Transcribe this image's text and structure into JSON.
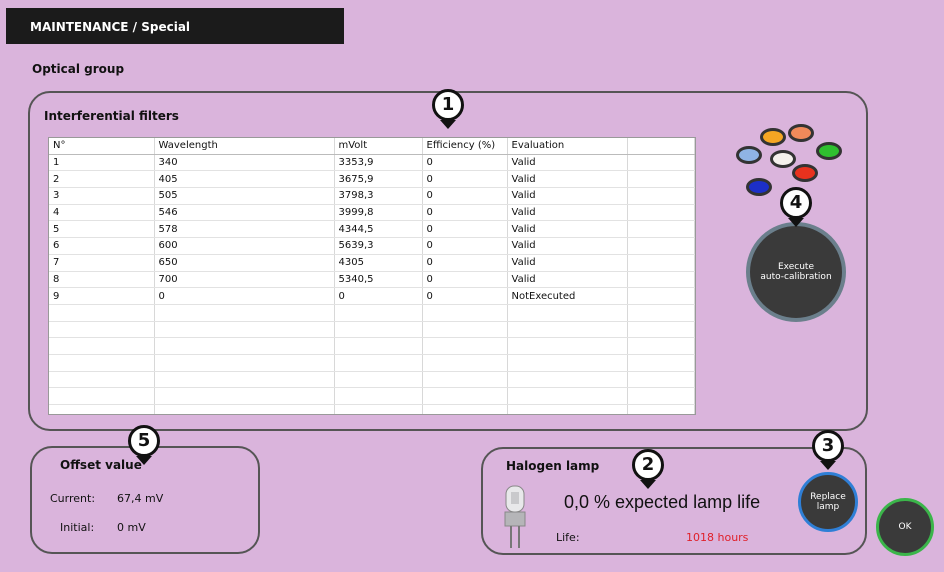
{
  "title": "MAINTENANCE / Special",
  "section": "Optical group",
  "filters_panel": {
    "title": "Interferential filters",
    "columns": [
      "N°",
      "Wavelength",
      "mVolt",
      "Efficiency (%)",
      "Evaluation",
      ""
    ],
    "rows": [
      [
        "1",
        "340",
        "3353,9",
        "0",
        "Valid",
        ""
      ],
      [
        "2",
        "405",
        "3675,9",
        "0",
        "Valid",
        ""
      ],
      [
        "3",
        "505",
        "3798,3",
        "0",
        "Valid",
        ""
      ],
      [
        "4",
        "546",
        "3999,8",
        "0",
        "Valid",
        ""
      ],
      [
        "5",
        "578",
        "4344,5",
        "0",
        "Valid",
        ""
      ],
      [
        "6",
        "600",
        "5639,3",
        "0",
        "Valid",
        ""
      ],
      [
        "7",
        "650",
        "4305",
        "0",
        "Valid",
        ""
      ],
      [
        "8",
        "700",
        "5340,5",
        "0",
        "Valid",
        ""
      ],
      [
        "9",
        "0",
        "0",
        "0",
        "NotExecuted",
        ""
      ],
      [
        "",
        "",
        "",
        "",
        "",
        ""
      ],
      [
        "",
        "",
        "",
        "",
        "",
        ""
      ],
      [
        "",
        "",
        "",
        "",
        "",
        ""
      ],
      [
        "",
        "",
        "",
        "",
        "",
        ""
      ],
      [
        "",
        "",
        "",
        "",
        "",
        ""
      ],
      [
        "",
        "",
        "",
        "",
        "",
        ""
      ],
      [
        "",
        "",
        "",
        "",
        "",
        ""
      ]
    ],
    "filter_colors": [
      "#8fb4e4",
      "#f5a623",
      "#f08a5a",
      "#f4f1ec",
      "#2fbf2f",
      "#e8321e",
      "#1c2fc8"
    ]
  },
  "calibration_button": {
    "line1": "Execute",
    "line2": "auto-calibration"
  },
  "offset_panel": {
    "title": "Offset value",
    "current_label": "Current:",
    "current_value": "67,4 mV",
    "initial_label": "Initial:",
    "initial_value": "0 mV"
  },
  "lamp_panel": {
    "title": "Halogen lamp",
    "expected_life": "0,0 % expected lamp life",
    "life_label": "Life:",
    "life_value": "1018 hours",
    "life_color": "#e0202a"
  },
  "replace_button": {
    "line1": "Replace",
    "line2": "lamp"
  },
  "ok_button": "OK",
  "badges": [
    "1",
    "2",
    "3",
    "4",
    "5"
  ]
}
